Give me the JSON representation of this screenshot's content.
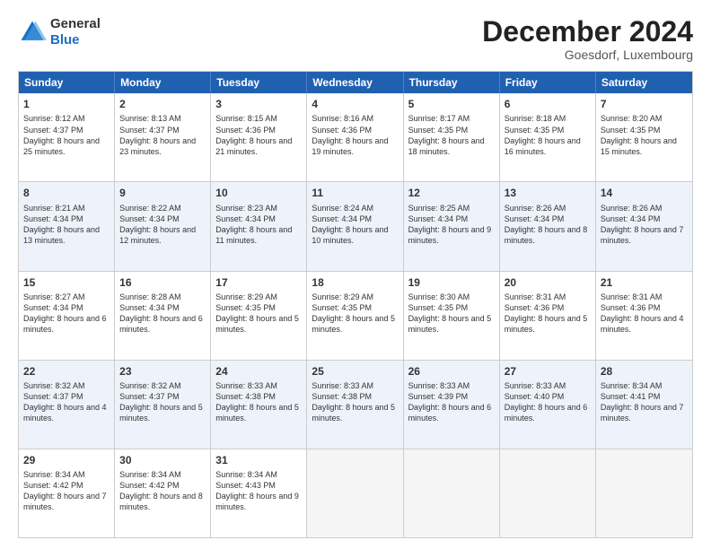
{
  "logo": {
    "general": "General",
    "blue": "Blue"
  },
  "title": "December 2024",
  "location": "Goesdorf, Luxembourg",
  "days": [
    "Sunday",
    "Monday",
    "Tuesday",
    "Wednesday",
    "Thursday",
    "Friday",
    "Saturday"
  ],
  "rows": [
    [
      {
        "day": "1",
        "sunrise": "8:12 AM",
        "sunset": "4:37 PM",
        "daylight": "8 hours and 25 minutes."
      },
      {
        "day": "2",
        "sunrise": "8:13 AM",
        "sunset": "4:37 PM",
        "daylight": "8 hours and 23 minutes."
      },
      {
        "day": "3",
        "sunrise": "8:15 AM",
        "sunset": "4:36 PM",
        "daylight": "8 hours and 21 minutes."
      },
      {
        "day": "4",
        "sunrise": "8:16 AM",
        "sunset": "4:36 PM",
        "daylight": "8 hours and 19 minutes."
      },
      {
        "day": "5",
        "sunrise": "8:17 AM",
        "sunset": "4:35 PM",
        "daylight": "8 hours and 18 minutes."
      },
      {
        "day": "6",
        "sunrise": "8:18 AM",
        "sunset": "4:35 PM",
        "daylight": "8 hours and 16 minutes."
      },
      {
        "day": "7",
        "sunrise": "8:20 AM",
        "sunset": "4:35 PM",
        "daylight": "8 hours and 15 minutes."
      }
    ],
    [
      {
        "day": "8",
        "sunrise": "8:21 AM",
        "sunset": "4:34 PM",
        "daylight": "8 hours and 13 minutes."
      },
      {
        "day": "9",
        "sunrise": "8:22 AM",
        "sunset": "4:34 PM",
        "daylight": "8 hours and 12 minutes."
      },
      {
        "day": "10",
        "sunrise": "8:23 AM",
        "sunset": "4:34 PM",
        "daylight": "8 hours and 11 minutes."
      },
      {
        "day": "11",
        "sunrise": "8:24 AM",
        "sunset": "4:34 PM",
        "daylight": "8 hours and 10 minutes."
      },
      {
        "day": "12",
        "sunrise": "8:25 AM",
        "sunset": "4:34 PM",
        "daylight": "8 hours and 9 minutes."
      },
      {
        "day": "13",
        "sunrise": "8:26 AM",
        "sunset": "4:34 PM",
        "daylight": "8 hours and 8 minutes."
      },
      {
        "day": "14",
        "sunrise": "8:26 AM",
        "sunset": "4:34 PM",
        "daylight": "8 hours and 7 minutes."
      }
    ],
    [
      {
        "day": "15",
        "sunrise": "8:27 AM",
        "sunset": "4:34 PM",
        "daylight": "8 hours and 6 minutes."
      },
      {
        "day": "16",
        "sunrise": "8:28 AM",
        "sunset": "4:34 PM",
        "daylight": "8 hours and 6 minutes."
      },
      {
        "day": "17",
        "sunrise": "8:29 AM",
        "sunset": "4:35 PM",
        "daylight": "8 hours and 5 minutes."
      },
      {
        "day": "18",
        "sunrise": "8:29 AM",
        "sunset": "4:35 PM",
        "daylight": "8 hours and 5 minutes."
      },
      {
        "day": "19",
        "sunrise": "8:30 AM",
        "sunset": "4:35 PM",
        "daylight": "8 hours and 5 minutes."
      },
      {
        "day": "20",
        "sunrise": "8:31 AM",
        "sunset": "4:36 PM",
        "daylight": "8 hours and 5 minutes."
      },
      {
        "day": "21",
        "sunrise": "8:31 AM",
        "sunset": "4:36 PM",
        "daylight": "8 hours and 4 minutes."
      }
    ],
    [
      {
        "day": "22",
        "sunrise": "8:32 AM",
        "sunset": "4:37 PM",
        "daylight": "8 hours and 4 minutes."
      },
      {
        "day": "23",
        "sunrise": "8:32 AM",
        "sunset": "4:37 PM",
        "daylight": "8 hours and 5 minutes."
      },
      {
        "day": "24",
        "sunrise": "8:33 AM",
        "sunset": "4:38 PM",
        "daylight": "8 hours and 5 minutes."
      },
      {
        "day": "25",
        "sunrise": "8:33 AM",
        "sunset": "4:38 PM",
        "daylight": "8 hours and 5 minutes."
      },
      {
        "day": "26",
        "sunrise": "8:33 AM",
        "sunset": "4:39 PM",
        "daylight": "8 hours and 6 minutes."
      },
      {
        "day": "27",
        "sunrise": "8:33 AM",
        "sunset": "4:40 PM",
        "daylight": "8 hours and 6 minutes."
      },
      {
        "day": "28",
        "sunrise": "8:34 AM",
        "sunset": "4:41 PM",
        "daylight": "8 hours and 7 minutes."
      }
    ],
    [
      {
        "day": "29",
        "sunrise": "8:34 AM",
        "sunset": "4:42 PM",
        "daylight": "8 hours and 7 minutes."
      },
      {
        "day": "30",
        "sunrise": "8:34 AM",
        "sunset": "4:42 PM",
        "daylight": "8 hours and 8 minutes."
      },
      {
        "day": "31",
        "sunrise": "8:34 AM",
        "sunset": "4:43 PM",
        "daylight": "8 hours and 9 minutes."
      },
      null,
      null,
      null,
      null
    ]
  ],
  "labels": {
    "sunrise": "Sunrise:",
    "sunset": "Sunset:",
    "daylight": "Daylight:"
  }
}
